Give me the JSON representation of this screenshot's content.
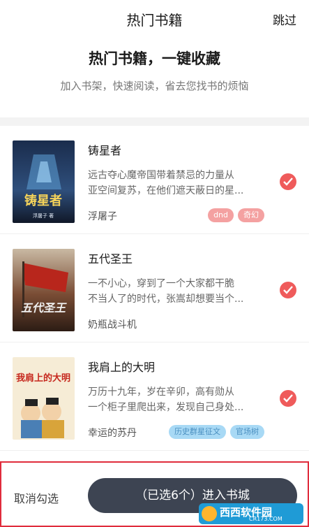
{
  "header": {
    "title": "热门书籍",
    "skip_label": "跳过"
  },
  "hero": {
    "title": "热门书籍，一键收藏",
    "subtitle": "加入书架，快速阅读，省去您找书的烦恼"
  },
  "books": [
    {
      "title": "铸星者",
      "desc_lines": [
        "远古夺心魔帝国带着禁忌的力量从",
        "亚空间复苏，在他们遮天蔽日的星..."
      ],
      "author": "浮屠子",
      "tags": [
        "dnd",
        "奇幻"
      ],
      "cover_text": "铸星者",
      "cover_author": "浮屠子 著"
    },
    {
      "title": "五代圣王",
      "desc_lines": [
        "一不小心，穿到了一个大家都干脆",
        "不当人了的时代，张嵩却想要当个..."
      ],
      "author": "奶瓶战斗机",
      "tags": [],
      "cover_text": "五代圣王"
    },
    {
      "title": "我肩上的大明",
      "desc_lines": [
        "万历十九年，岁在辛卯，高有勋从",
        "一个柜子里爬出来，发现自己身处..."
      ],
      "author": "幸运的苏丹",
      "tags": [
        "历史群星征文",
        "官场树"
      ],
      "cover_text": "我肩上的大明"
    }
  ],
  "footer": {
    "cancel_label": "取消勾选",
    "enter_label": "（已选6个）进入书城"
  },
  "watermark": {
    "main": "西西软件园",
    "sub": "CR173.COM"
  },
  "colors": {
    "accent_red": "#ef5b5b",
    "button_dark": "#3d4452",
    "highlight_border": "#e02c3c"
  }
}
